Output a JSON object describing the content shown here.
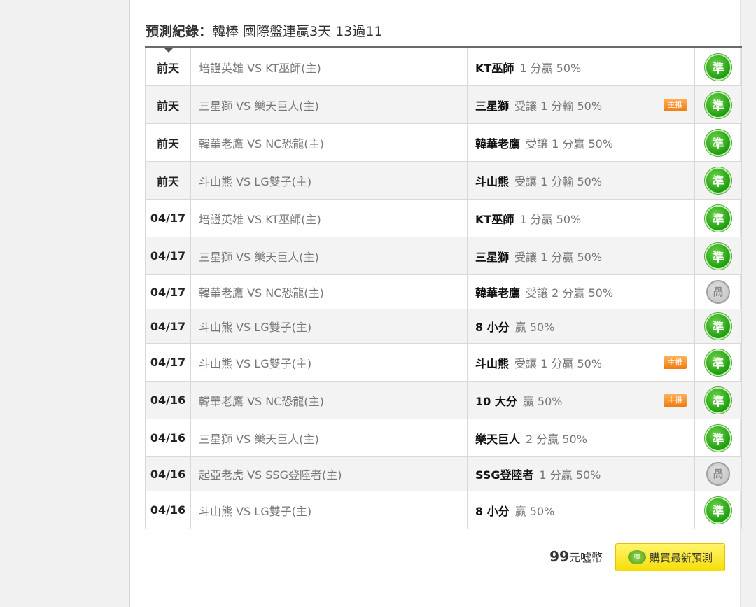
{
  "heading": {
    "label": "預測紀錄：",
    "summary": "韓棒 國際盤連贏3天 13過11"
  },
  "rows": [
    {
      "date": "前天",
      "match": "培證英雄 VS KT巫師(主)",
      "pick_team": "KT巫師",
      "pick_odds": "1 分贏 50%",
      "main_badge": "",
      "result": "準",
      "result_type": "win"
    },
    {
      "date": "前天",
      "match": "三星獅 VS 樂天巨人(主)",
      "pick_team": "三星獅",
      "pick_odds": "受讓 1 分輸 50%",
      "main_badge": "主推",
      "result": "準",
      "result_type": "win"
    },
    {
      "date": "前天",
      "match": "韓華老鷹 VS NC恐龍(主)",
      "pick_team": "韓華老鷹",
      "pick_odds": "受讓 1 分贏 50%",
      "main_badge": "",
      "result": "準",
      "result_type": "win"
    },
    {
      "date": "前天",
      "match": "斗山熊 VS LG雙子(主)",
      "pick_team": "斗山熊",
      "pick_odds": "受讓 1 分輸 50%",
      "main_badge": "",
      "result": "準",
      "result_type": "win"
    },
    {
      "date": "04/17",
      "match": "培證英雄 VS KT巫師(主)",
      "pick_team": "KT巫師",
      "pick_odds": "1 分贏 50%",
      "main_badge": "",
      "result": "準",
      "result_type": "win"
    },
    {
      "date": "04/17",
      "match": "三星獅 VS 樂天巨人(主)",
      "pick_team": "三星獅",
      "pick_odds": "受讓 1 分贏 50%",
      "main_badge": "",
      "result": "準",
      "result_type": "win"
    },
    {
      "date": "04/17",
      "match": "韓華老鷹 VS NC恐龍(主)",
      "pick_team": "韓華老鷹",
      "pick_odds": "受讓 2 分贏 50%",
      "main_badge": "",
      "result": "咼",
      "result_type": "push"
    },
    {
      "date": "04/17",
      "match": "斗山熊 VS LG雙子(主)",
      "pick_team": "8 小分",
      "pick_odds": "贏 50%",
      "main_badge": "",
      "result": "準",
      "result_type": "win"
    },
    {
      "date": "04/17",
      "match": "斗山熊 VS LG雙子(主)",
      "pick_team": "斗山熊",
      "pick_odds": "受讓 1 分贏 50%",
      "main_badge": "主推",
      "result": "準",
      "result_type": "win"
    },
    {
      "date": "04/16",
      "match": "韓華老鷹 VS NC恐龍(主)",
      "pick_team": "10 大分",
      "pick_odds": "贏 50%",
      "main_badge": "主推",
      "result": "準",
      "result_type": "win"
    },
    {
      "date": "04/16",
      "match": "三星獅 VS 樂天巨人(主)",
      "pick_team": "樂天巨人",
      "pick_odds": "2 分贏 50%",
      "main_badge": "",
      "result": "準",
      "result_type": "win"
    },
    {
      "date": "04/16",
      "match": "起亞老虎 VS SSG登陸者(主)",
      "pick_team": "SSG登陸者",
      "pick_odds": "1 分贏 50%",
      "main_badge": "",
      "result": "咼",
      "result_type": "push"
    },
    {
      "date": "04/16",
      "match": "斗山熊 VS LG雙子(主)",
      "pick_team": "8 小分",
      "pick_odds": "贏 50%",
      "main_badge": "",
      "result": "準",
      "result_type": "win"
    }
  ],
  "footer": {
    "price": "99",
    "price_unit": "元噓幣",
    "buy_icon_text": "噓",
    "buy_label": "購買最新預測"
  },
  "colors": {
    "win": "#219d12",
    "push": "#bcbcbc",
    "main_badge": "#f07c10",
    "buy_button": "#f7de0a"
  }
}
